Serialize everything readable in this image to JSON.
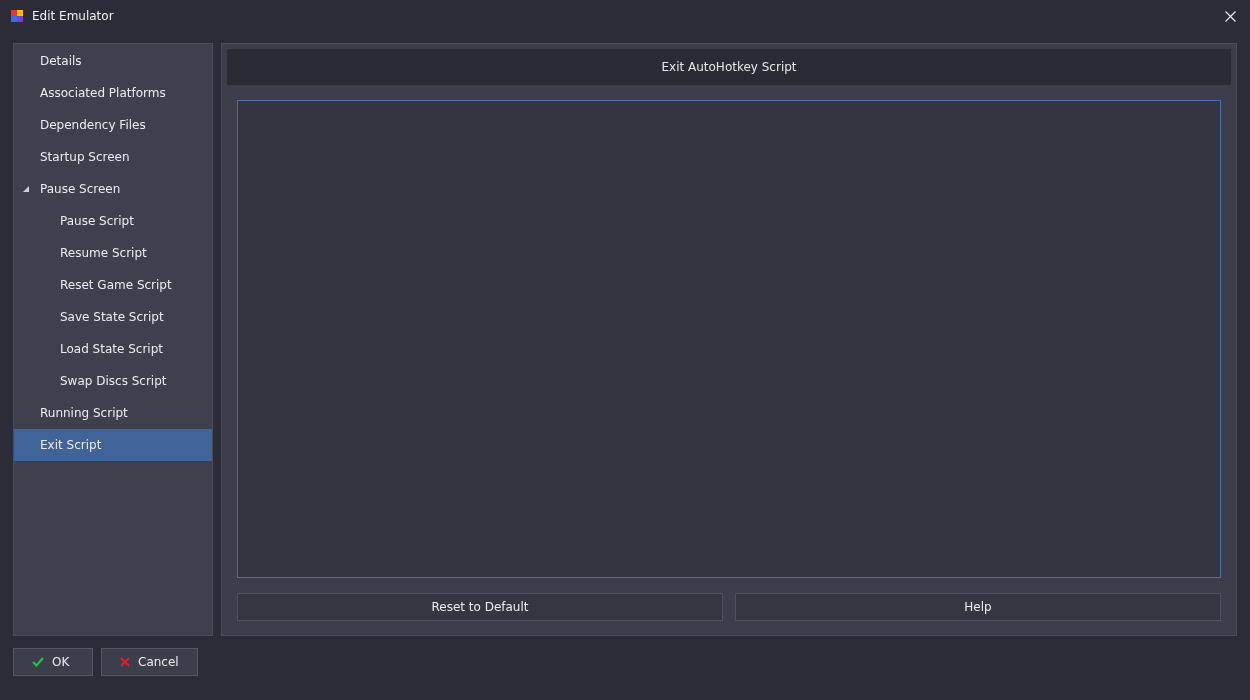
{
  "window": {
    "title": "Edit Emulator"
  },
  "sidebar": {
    "items": [
      {
        "label": "Details",
        "selected": false
      },
      {
        "label": "Associated Platforms",
        "selected": false
      },
      {
        "label": "Dependency Files",
        "selected": false
      },
      {
        "label": "Startup Screen",
        "selected": false
      },
      {
        "label": "Pause Screen",
        "selected": false,
        "expanded": true,
        "children": [
          {
            "label": "Pause Script",
            "selected": false
          },
          {
            "label": "Resume Script",
            "selected": false
          },
          {
            "label": "Reset Game Script",
            "selected": false
          },
          {
            "label": "Save State Script",
            "selected": false
          },
          {
            "label": "Load State Script",
            "selected": false
          },
          {
            "label": "Swap Discs Script",
            "selected": false
          }
        ]
      },
      {
        "label": "Running Script",
        "selected": false
      },
      {
        "label": "Exit Script",
        "selected": true
      }
    ]
  },
  "editor": {
    "header": "Exit AutoHotkey Script",
    "buttons": [
      "Reset to Default",
      "Help"
    ]
  },
  "footer": {
    "buttons": [
      {
        "label": "OK",
        "kind": "ok"
      },
      {
        "label": "Cancel",
        "kind": "cancel"
      }
    ]
  }
}
